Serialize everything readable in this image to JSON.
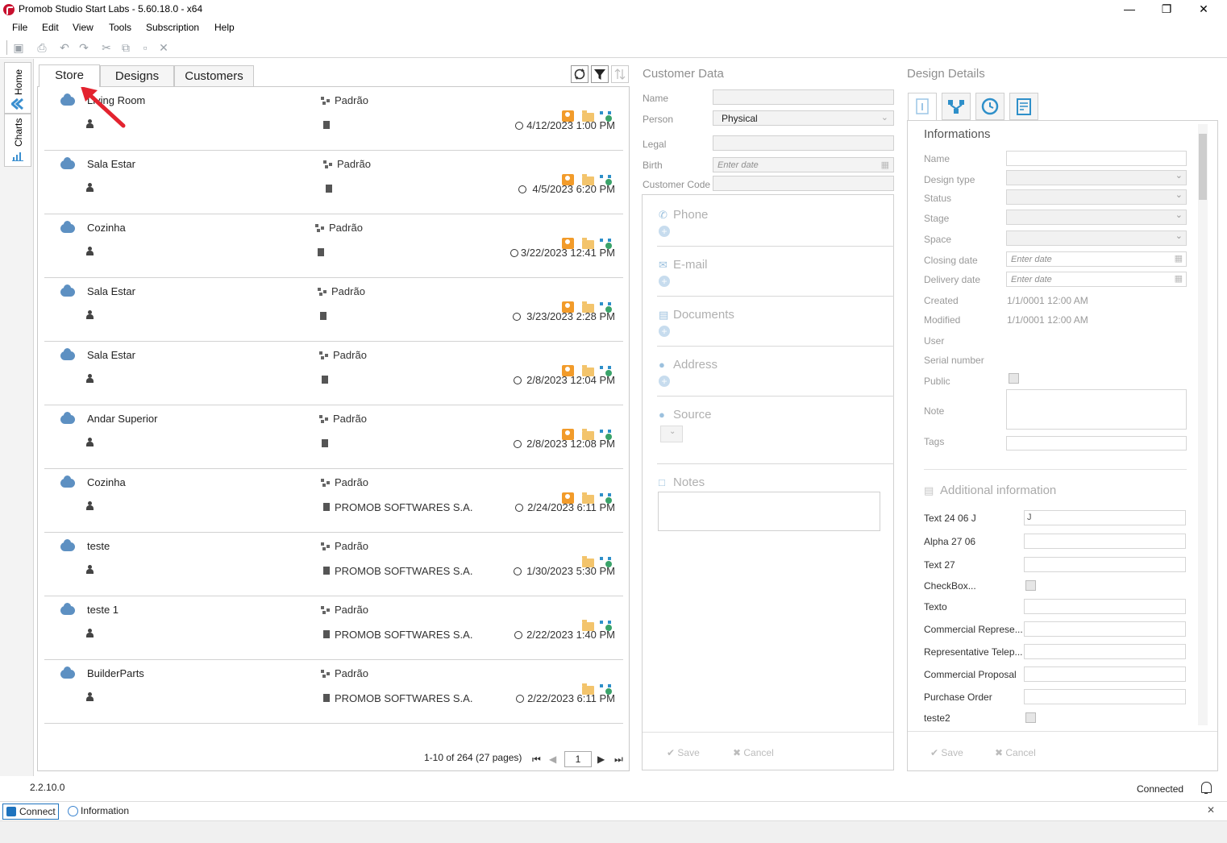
{
  "window": {
    "title": "Promob Studio Start Labs - 5.60.18.0 - x64",
    "minimize": "—",
    "maximize": "❐",
    "close": "✕"
  },
  "menu": [
    "File",
    "Edit",
    "View",
    "Tools",
    "Subscription",
    "Help"
  ],
  "side_tabs": {
    "home": "Home",
    "charts": "Charts"
  },
  "tabs": {
    "store": "Store",
    "designs": "Designs",
    "customers": "Customers"
  },
  "rows": [
    {
      "name": "Living Room",
      "design": "Padrão",
      "company": "",
      "date": "4/12/2023 1:00 PM",
      "has_user": true
    },
    {
      "name": "Sala Estar",
      "design": "Padrão",
      "company": "",
      "date": "4/5/2023 6:20 PM",
      "has_user": true
    },
    {
      "name": "Cozinha",
      "design": "Padrão",
      "company": "",
      "date": "3/22/2023 12:41 PM",
      "has_user": true
    },
    {
      "name": "Sala Estar",
      "design": "Padrão",
      "company": "",
      "date": "3/23/2023 2:28 PM",
      "has_user": true
    },
    {
      "name": "Sala Estar",
      "design": "Padrão",
      "company": "",
      "date": "2/8/2023 12:04 PM",
      "has_user": true
    },
    {
      "name": "Andar Superior",
      "design": "Padrão",
      "company": "",
      "date": "2/8/2023 12:08 PM",
      "has_user": true
    },
    {
      "name": "Cozinha",
      "design": "Padrão",
      "company": "PROMOB SOFTWARES S.A.",
      "date": "2/24/2023 6:11 PM",
      "has_user": true
    },
    {
      "name": "teste",
      "design": "Padrão",
      "company": "PROMOB SOFTWARES S.A.",
      "date": "1/30/2023 5:30 PM",
      "has_user": false
    },
    {
      "name": "teste 1",
      "design": "Padrão",
      "company": "PROMOB SOFTWARES S.A.",
      "date": "2/22/2023 1:40 PM",
      "has_user": false
    },
    {
      "name": "BuilderParts",
      "design": "Padrão",
      "company": "PROMOB SOFTWARES S.A.",
      "date": "2/22/2023 6:11 PM",
      "has_user": false
    }
  ],
  "pager": {
    "summary": "1-10 of 264 (27 pages)",
    "page": "1"
  },
  "customer": {
    "title": "Customer Data",
    "name_label": "Name",
    "person_label": "Person",
    "person_value": "Physical",
    "legal_label": "Legal",
    "birth_label": "Birth",
    "birth_placeholder": "Enter date",
    "code_label": "Customer Code",
    "sections": [
      "Phone",
      "E-mail",
      "Documents",
      "Address",
      "Source",
      "Notes"
    ],
    "save": "Save",
    "cancel": "Cancel"
  },
  "design": {
    "title": "Design Details",
    "info_title": "Informations",
    "labels": [
      "Name",
      "Design type",
      "Status",
      "Stage",
      "Space",
      "Closing date",
      "Delivery date",
      "Created",
      "Modified",
      "User",
      "Serial number",
      "Public",
      "Note",
      "Tags"
    ],
    "date_placeholder": "Enter date",
    "created_value": "1/1/0001 12:00 AM",
    "modified_value": "1/1/0001 12:00 AM",
    "additional_title": "Additional information",
    "additional": [
      "Text 24 06 J",
      "Alpha 27 06",
      "Text 27",
      "CheckBox...",
      "Texto",
      "Commercial Represe...",
      "Representative Telep...",
      "Commercial Proposal",
      "Purchase Order",
      "teste2"
    ],
    "text24_value": "J",
    "save": "Save",
    "cancel": "Cancel"
  },
  "status": {
    "version": "2.2.10.0",
    "connected": "Connected",
    "connect_button": "Connect",
    "information": "Information",
    "close": "✕"
  }
}
